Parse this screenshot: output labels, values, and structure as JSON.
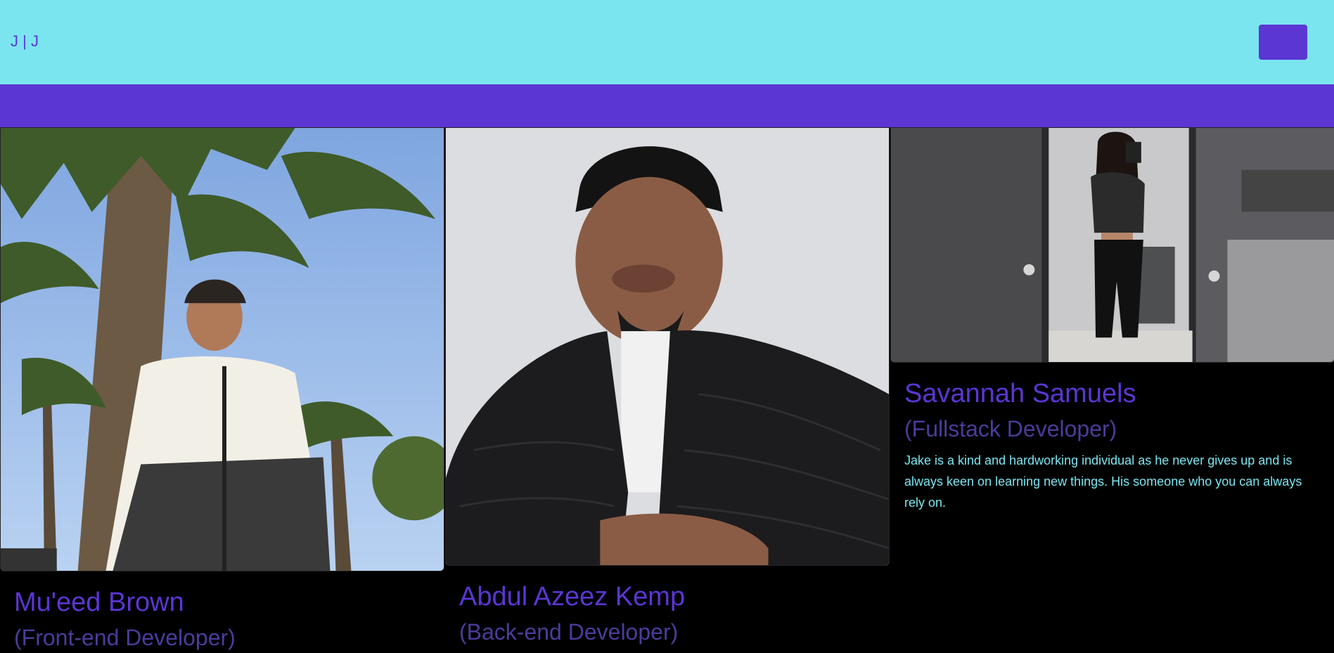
{
  "nav": {
    "brand": "J | J"
  },
  "team": [
    {
      "name": "Mu'eed Brown",
      "role": "(Front-end Developer)"
    },
    {
      "name": "Abdul Azeez Kemp",
      "role": "(Back-end Developer)"
    },
    {
      "name": "Savannah Samuels",
      "role": "(Fullstack Developer)",
      "bio": "Jake is a kind and hardworking individual as he never gives up and is always keen on learning new things. His someone who you can always rely on."
    }
  ],
  "colors": {
    "nav_bg": "#7be5ef",
    "accent": "#5b36d3",
    "role_text": "#4a3c9a",
    "bio_text": "#7be5ef",
    "page_bg": "#000000"
  }
}
